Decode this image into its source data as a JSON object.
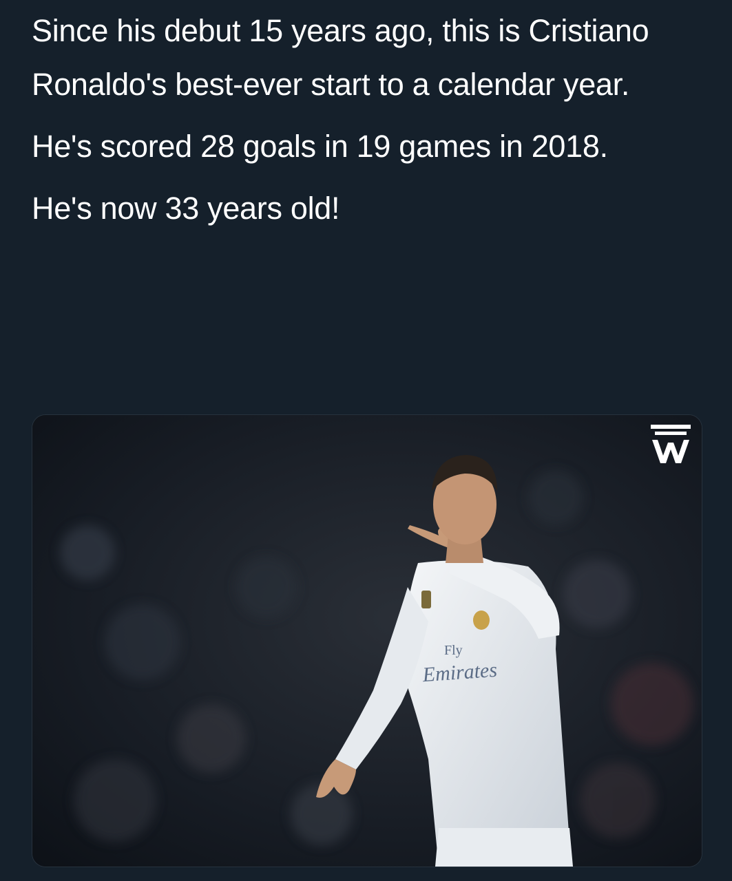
{
  "tweet": {
    "paragraphs": [
      "Since his debut 15 years ago, this is Cristiano Ronaldo's best-ever start to a calendar year.",
      "He's scored 28 goals in 19 games in 2018.",
      "He's now 33 years old!"
    ]
  },
  "media": {
    "jersey_sponsor_line1": "Fly",
    "jersey_sponsor_line2": "Emirates",
    "watermark_icon": "w-logo-icon"
  },
  "colors": {
    "background": "#15202b",
    "text": "#ffffff"
  }
}
